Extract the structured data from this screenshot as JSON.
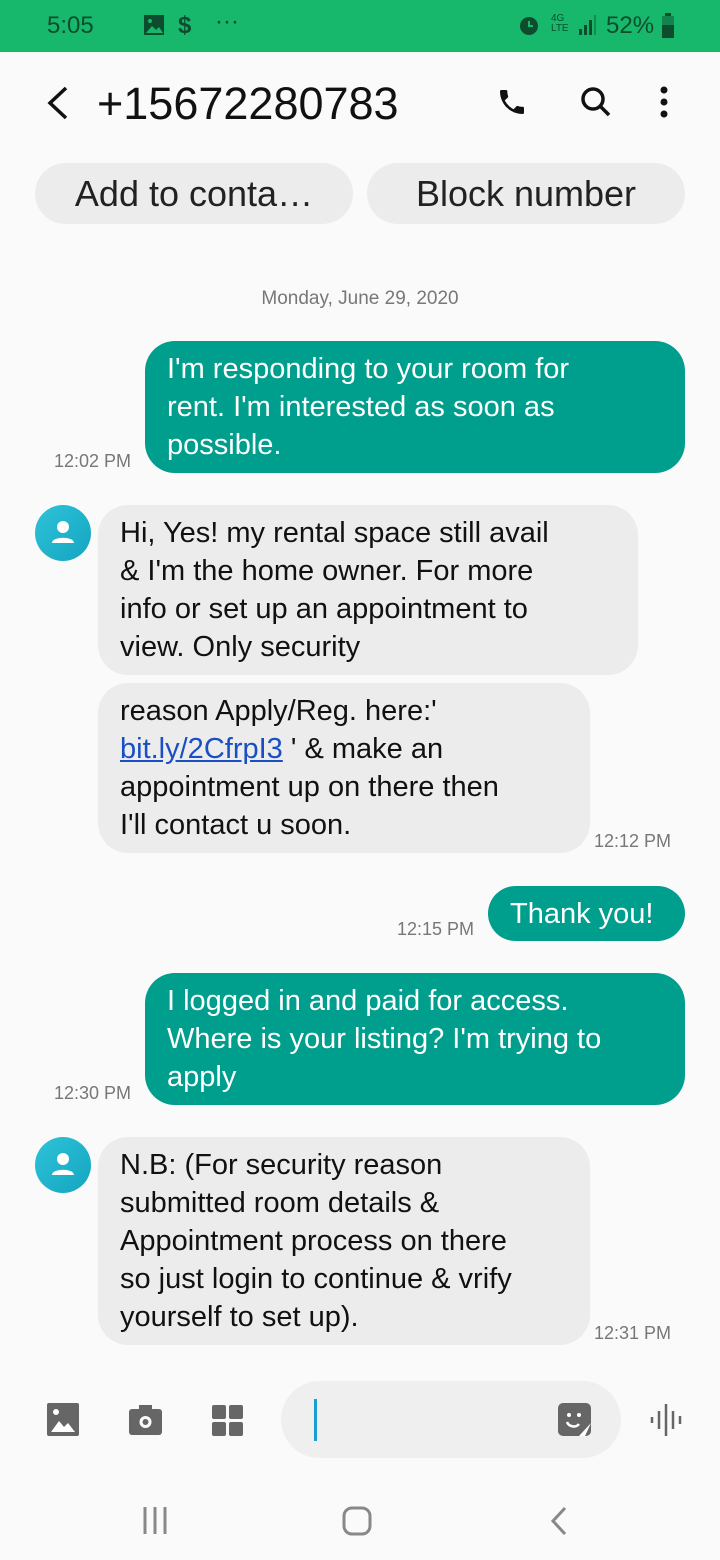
{
  "status_bar": {
    "time": "5:05",
    "battery": "52%",
    "icons": [
      "image-icon",
      "dollar-icon",
      "more-icon",
      "alarm-icon",
      "lte-icon",
      "signal-icon",
      "battery-icon"
    ]
  },
  "header": {
    "title": "+15672280783",
    "actions": [
      "back-icon",
      "phone-icon",
      "search-icon",
      "more-vert-icon"
    ]
  },
  "quick_actions": {
    "add_contact": "Add to conta…",
    "block": "Block number"
  },
  "conversation": {
    "date": "Monday, June 29, 2020",
    "messages": [
      {
        "type": "sent",
        "text": "I'm responding to your room for\nrent. I'm interested as soon as\npossible.",
        "time": "12:02 PM"
      },
      {
        "type": "received",
        "text": "Hi, Yes! my rental space still avail\n& I'm the home owner. For more\ninfo or set up an appointment to\nview. Only security"
      },
      {
        "type": "received",
        "text_before": "reason Apply/Reg. here:'",
        "link": "bit.ly/2CfrpI3",
        "text_after": " ' & make an\nappointment up on there then\nI'll contact u soon.",
        "time": "12:12 PM"
      },
      {
        "type": "sent",
        "text": "Thank you!",
        "time": "12:15 PM"
      },
      {
        "type": "sent",
        "text": "I logged in and paid for access.\nWhere is your listing? I'm trying to\napply",
        "time": "12:30 PM"
      },
      {
        "type": "received",
        "text": "N.B: (For security reason\nsubmitted room details &\nAppointment process on there\nso just login to continue & vrify\nyourself to set up).",
        "time": "12:31 PM"
      }
    ]
  },
  "composer": {
    "placeholder": "",
    "icons": [
      "gallery-icon",
      "camera-icon",
      "apps-icon",
      "sticker-icon",
      "voice-icon"
    ]
  },
  "nav": {
    "icons": [
      "recents-icon",
      "home-icon",
      "back-nav-icon"
    ]
  },
  "colors": {
    "status_bar": "#17b86b",
    "sent_bubble": "#009e8c",
    "received_bubble": "#ececec",
    "link": "#1a4fc4",
    "cursor": "#1a9fd0"
  }
}
